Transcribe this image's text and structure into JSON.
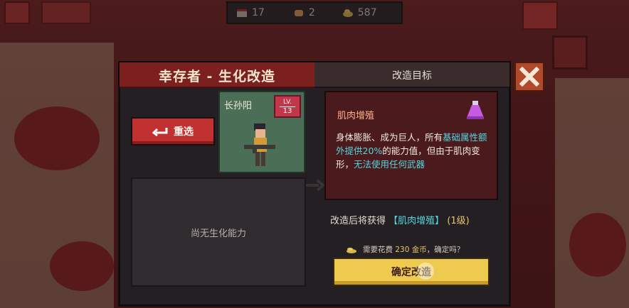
{
  "hud": {
    "days": "17",
    "food": "2",
    "gold": "587"
  },
  "dialog": {
    "title": "幸存者 - 生化改造",
    "target_header": "改造目标",
    "reselect_label": "重选",
    "empty_ability": "尚无生化能力"
  },
  "character": {
    "name": "长孙阳",
    "lv_label": "LV.",
    "level": "13"
  },
  "target": {
    "name": "肌肉增殖",
    "desc_parts": {
      "p1": "身体膨胀、成为巨人，所有",
      "p2": "基础属性额外提供20%",
      "p3": "的能力值，但由于肌肉变形，",
      "p4": "无法使用任何武器"
    }
  },
  "gain": {
    "prefix": "改造后将获得",
    "name_bracketed": "【肌肉增殖】",
    "level": "(1级)"
  },
  "cost": {
    "prefix": "需要花费",
    "amount": "230 金币",
    "suffix": "，确定吗？"
  },
  "confirm_label": "确定改造",
  "colors": {
    "accent_red": "#c23131",
    "confirm_yellow": "#eecb4f",
    "highlight_cyan": "#54d6e0"
  }
}
